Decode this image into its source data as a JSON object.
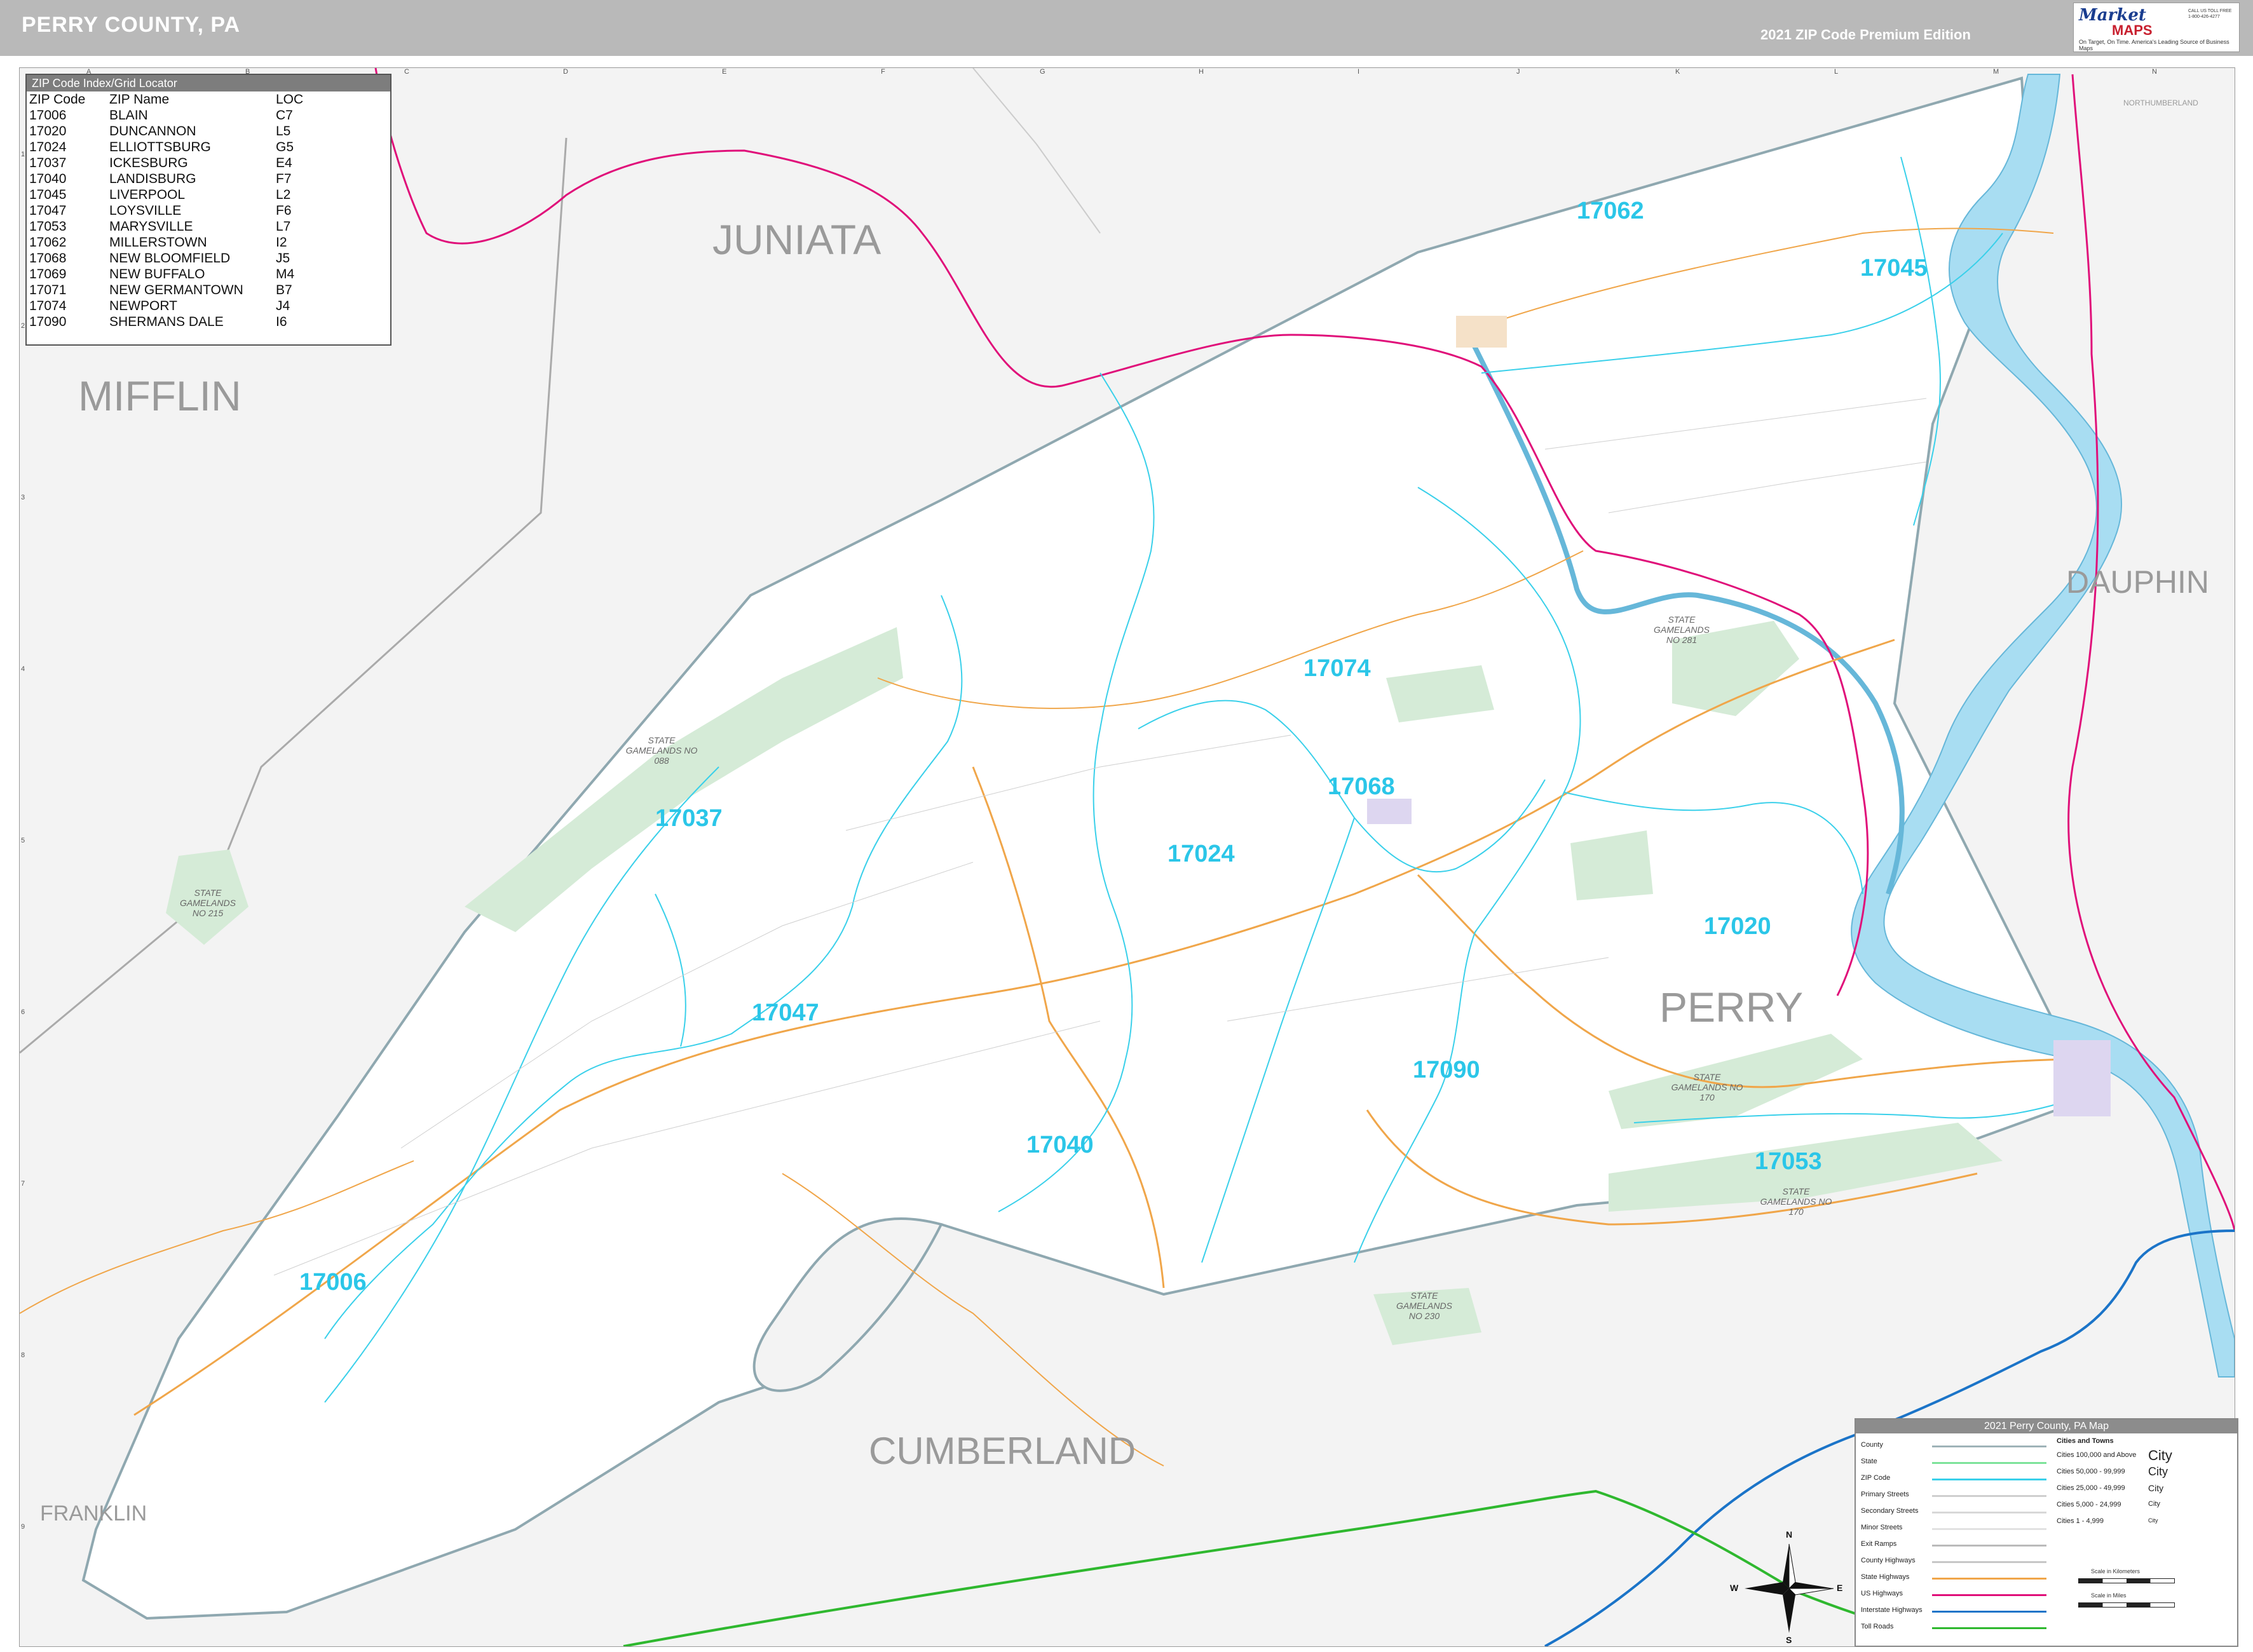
{
  "header": {
    "title": "PERRY COUNTY, PA",
    "edition": "2021 ZIP Code Premium Edition",
    "logo": {
      "name_line1": "Market",
      "name_line2": "MAPS",
      "tagline": "On Target, On Time. America's Leading Source of Business Maps",
      "phone": "CALL US TOLL FREE 1-800-426-4277"
    }
  },
  "grid": {
    "columns": [
      "A",
      "B",
      "C",
      "D",
      "E",
      "F",
      "G",
      "H",
      "I",
      "J",
      "K",
      "L",
      "M",
      "N"
    ],
    "rows": [
      "1",
      "2",
      "3",
      "4",
      "5",
      "6",
      "7",
      "8",
      "9"
    ]
  },
  "counties": {
    "juniata": "JUNIATA",
    "mifflin": "MIFFLIN",
    "dauphin": "DAUPHIN",
    "perry": "PERRY",
    "cumberland": "CUMBERLAND",
    "franklin": "FRANKLIN",
    "northumberland": "NORTHUMBERLAND"
  },
  "zip_labels": [
    "17062",
    "17045",
    "17074",
    "17068",
    "17037",
    "17024",
    "17020",
    "17047",
    "17090",
    "17040",
    "17053",
    "17006"
  ],
  "gamelands": {
    "g088": "STATE GAMELANDS NO 088",
    "g281": "STATE GAMELANDS NO 281",
    "g170a": "STATE GAMELANDS NO 170",
    "g170b": "STATE GAMELANDS NO 170",
    "g230": "STATE GAMELANDS NO 230",
    "g215": "STATE GAMELANDS NO 215"
  },
  "index": {
    "header": "ZIP Code Index/Grid Locator",
    "columns": [
      "ZIP Code",
      "ZIP Name",
      "LOC"
    ],
    "rows": [
      [
        "17006",
        "BLAIN",
        "C7"
      ],
      [
        "17020",
        "DUNCANNON",
        "L5"
      ],
      [
        "17024",
        "ELLIOTTSBURG",
        "G5"
      ],
      [
        "17037",
        "ICKESBURG",
        "E4"
      ],
      [
        "17040",
        "LANDISBURG",
        "F7"
      ],
      [
        "17045",
        "LIVERPOOL",
        "L2"
      ],
      [
        "17047",
        "LOYSVILLE",
        "F6"
      ],
      [
        "17053",
        "MARYSVILLE",
        "L7"
      ],
      [
        "17062",
        "MILLERSTOWN",
        "I2"
      ],
      [
        "17068",
        "NEW BLOOMFIELD",
        "J5"
      ],
      [
        "17069",
        "NEW BUFFALO",
        "M4"
      ],
      [
        "17071",
        "NEW GERMANTOWN",
        "B7"
      ],
      [
        "17074",
        "NEWPORT",
        "J4"
      ],
      [
        "17090",
        "SHERMANS DALE",
        "I6"
      ]
    ]
  },
  "legend": {
    "title": "2021 Perry County, PA Map",
    "line_items": [
      "County",
      "State",
      "ZIP Code",
      "Primary Streets",
      "Secondary Streets",
      "Minor Streets",
      "Exit Ramps",
      "County Highways",
      "State Highways",
      "US Highways",
      "Interstate Highways",
      "Toll Roads"
    ],
    "line_colors": [
      "#9fb3b8",
      "#7de39a",
      "#3ad0ea",
      "#cfcfcf",
      "#d8d8d8",
      "#e2e2e2",
      "#bbbbbb",
      "#c7c7c7",
      "#f0a64a",
      "#e0107a",
      "#1b74c8",
      "#2fb82f"
    ],
    "cities_header": "Cities and Towns",
    "city_classes": [
      {
        "label": "Cities 100,000 and Above",
        "sample": "City"
      },
      {
        "label": "Cities 50,000 - 99,999",
        "sample": "City"
      },
      {
        "label": "Cities 25,000 - 49,999",
        "sample": "City"
      },
      {
        "label": "Cities 5,000 - 24,999",
        "sample": "City"
      },
      {
        "label": "Cities 1 - 4,999",
        "sample": "City"
      }
    ],
    "scale_km": "Scale in Kilometers",
    "scale_mi": "Scale in Miles"
  },
  "compass": {
    "n": "N",
    "s": "S",
    "e": "E",
    "w": "W"
  }
}
